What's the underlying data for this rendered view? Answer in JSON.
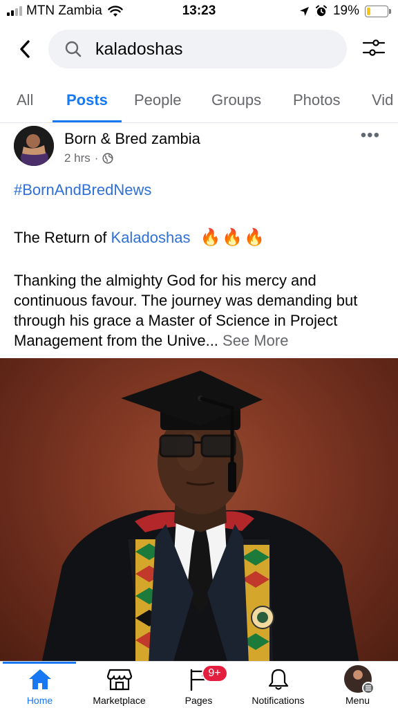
{
  "status_bar": {
    "carrier": "MTN Zambia",
    "time": "13:23",
    "battery": "19%",
    "battery_level": 0.19,
    "icons": [
      "signal-icon",
      "wifi-icon",
      "location-icon",
      "alarm-icon",
      "battery-icon"
    ]
  },
  "search": {
    "query": "kaladoshas",
    "icons": [
      "back-icon",
      "search-icon",
      "filter-icon"
    ]
  },
  "tabs": [
    {
      "label": "All",
      "active": false
    },
    {
      "label": "Posts",
      "active": true
    },
    {
      "label": "People",
      "active": false
    },
    {
      "label": "Groups",
      "active": false
    },
    {
      "label": "Photos",
      "active": false
    },
    {
      "label": "Vid",
      "active": false
    }
  ],
  "post": {
    "author": "Born & Bred zambia",
    "time": "2 hrs",
    "separator": "·",
    "privacy_icon": "globe-icon",
    "more_label": "•••",
    "hashtag": "#BornAndBredNews",
    "title_prefix": "The Return of",
    "title_link": "Kaladoshas",
    "title_emoji": "🔥🔥🔥",
    "body": "Thanking the almighty God for his mercy and continuous favour. The journey was demanding but through his grace a Master of Science in Project Management from the Unive...",
    "see_more": "See More",
    "photo": "graduation-portrait"
  },
  "bottom_nav": {
    "items": [
      {
        "label": "Home",
        "icon": "home-icon",
        "active": true
      },
      {
        "label": "Marketplace",
        "icon": "marketplace-icon",
        "active": false
      },
      {
        "label": "Pages",
        "icon": "pages-icon",
        "active": false,
        "badge": "9+"
      },
      {
        "label": "Notifications",
        "icon": "bell-icon",
        "active": false
      },
      {
        "label": "Menu",
        "icon": "avatar",
        "active": false
      }
    ]
  },
  "colors": {
    "accent": "#1877f2",
    "link": "#2e6fd8",
    "badge": "#e41e3f",
    "battery": "#f5c518"
  }
}
